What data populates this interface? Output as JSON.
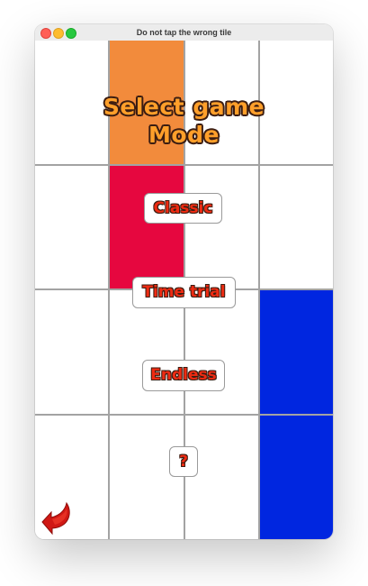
{
  "window": {
    "title": "Do not tap the wrong tile"
  },
  "menu": {
    "heading_line1": "Select game",
    "heading_line2": "Mode",
    "buttons": {
      "classic": "Classic",
      "time_trial": "Time trial",
      "endless": "Endless",
      "help": "?"
    }
  },
  "tiles": {
    "orange": "#f28b3c",
    "red": "#e6073f",
    "blue": "#0026e0",
    "grid": "#a3a3a3"
  },
  "icons": {
    "back": "back-arrow-icon"
  }
}
